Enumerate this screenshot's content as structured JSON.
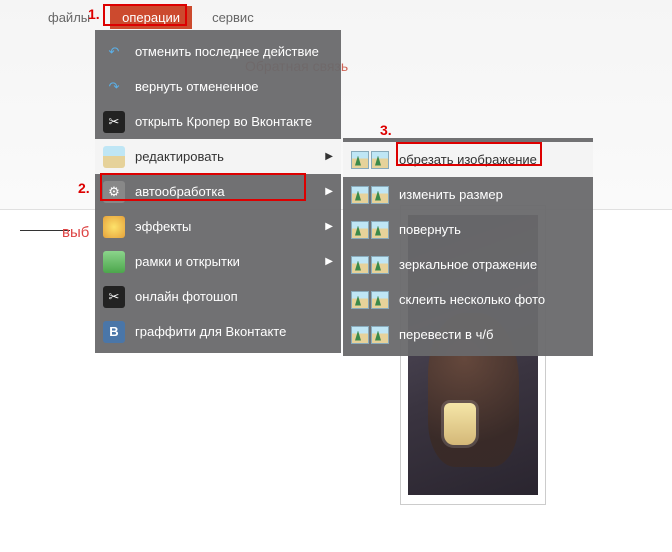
{
  "menubar": {
    "items": [
      {
        "label": "файлы"
      },
      {
        "label": "операции"
      },
      {
        "label": "сервис"
      }
    ]
  },
  "markers": {
    "m1": "1.",
    "m2": "2.",
    "m3": "3."
  },
  "side_label": "выб",
  "bg_feedback": "Обратная связь",
  "menu": {
    "items": [
      {
        "label": "отменить последнее действие"
      },
      {
        "label": "вернуть отмененное"
      },
      {
        "label": "открыть Кропер во Вконтакте"
      },
      {
        "label": "редактировать"
      },
      {
        "label": "автообработка"
      },
      {
        "label": "эффекты"
      },
      {
        "label": "рамки и открытки"
      },
      {
        "label": "онлайн фотошоп"
      },
      {
        "label": "граффити для Вконтакте"
      }
    ]
  },
  "submenu": {
    "items": [
      {
        "label": "обрезать изображение"
      },
      {
        "label": "изменить размер"
      },
      {
        "label": "повернуть"
      },
      {
        "label": "зеркальное отражение"
      },
      {
        "label": "склеить несколько фото"
      },
      {
        "label": "перевести в ч/б"
      }
    ]
  }
}
